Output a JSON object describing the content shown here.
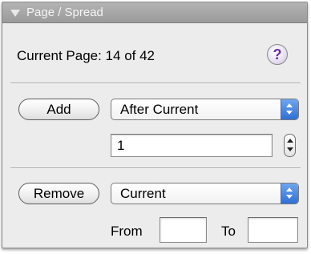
{
  "panel": {
    "title": "Page / Spread"
  },
  "status": {
    "current_page": "Current Page: 14 of 42",
    "help_glyph": "?"
  },
  "add_section": {
    "button_label": "Add",
    "position_select": "After Current",
    "count_value": "1"
  },
  "remove_section": {
    "button_label": "Remove",
    "range_select": "Current",
    "from_label": "From",
    "from_value": "",
    "to_label": "To",
    "to_value": ""
  },
  "colors": {
    "select_arrow_accent": "#3a7ee0",
    "help_icon": "#6a2ea0"
  }
}
